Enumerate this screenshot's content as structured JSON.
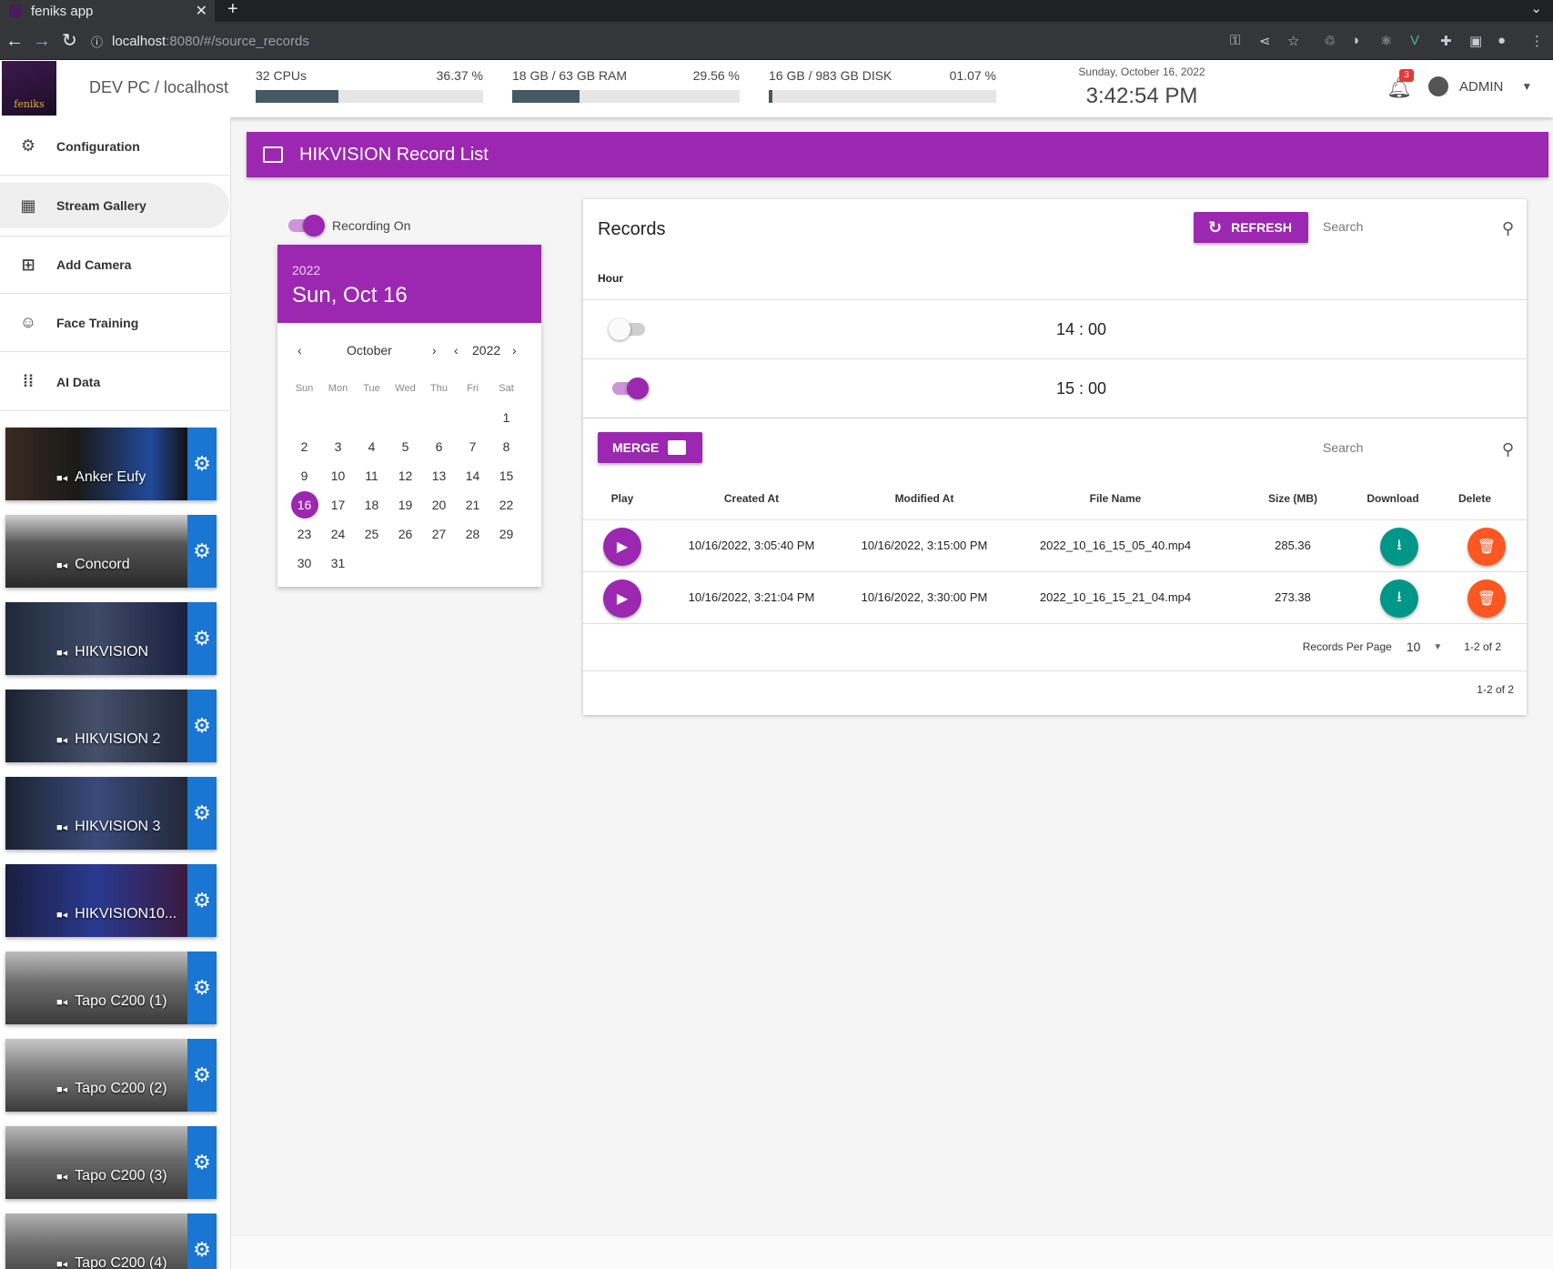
{
  "browser": {
    "tab_title": "feniks app",
    "url_host": "localhost",
    "url_rest": ":8080/#/source_records"
  },
  "header": {
    "logo_text": "feniks",
    "host": "DEV PC / localhost",
    "cpu": {
      "label": "32 CPUs",
      "percent_text": "36.37 %",
      "value": 0.3637
    },
    "ram": {
      "label": "18 GB / 63 GB RAM",
      "percent_text": "29.56 %",
      "value": 0.2956
    },
    "disk": {
      "label": "16 GB / 983 GB DISK",
      "percent_text": "01.07 %",
      "value": 0.0107
    },
    "date": "Sunday, October 16, 2022",
    "time": "3:42:54 PM",
    "notifications": "3",
    "user": "ADMIN"
  },
  "sidebar": {
    "items": [
      {
        "label": "Configuration",
        "icon": "gear-icon"
      },
      {
        "label": "Stream Gallery",
        "icon": "grid-icon"
      },
      {
        "label": "Add Camera",
        "icon": "add-box-icon"
      },
      {
        "label": "Face Training",
        "icon": "face-icon"
      },
      {
        "label": "AI Data",
        "icon": "dots-grid-icon"
      }
    ],
    "cameras": [
      {
        "name": "Anker Eufy"
      },
      {
        "name": "Concord"
      },
      {
        "name": "HIKVISION"
      },
      {
        "name": "HIKVISION 2"
      },
      {
        "name": "HIKVISION 3"
      },
      {
        "name": "HIKVISION10..."
      },
      {
        "name": "Tapo C200 (1)"
      },
      {
        "name": "Tapo C200 (2)"
      },
      {
        "name": "Tapo C200 (3)"
      },
      {
        "name": "Tapo C200 (4)"
      }
    ]
  },
  "page": {
    "title": "HIKVISION Record List",
    "recording_label": "Recording On",
    "recording_on": true
  },
  "calendar": {
    "year": "2022",
    "selected": "Sun, Oct 16",
    "month_name": "October",
    "weekdays": [
      "Sun",
      "Mon",
      "Tue",
      "Wed",
      "Thu",
      "Fri",
      "Sat"
    ],
    "weeks": [
      [
        "",
        "",
        "",
        "",
        "",
        "",
        "1"
      ],
      [
        "2",
        "3",
        "4",
        "5",
        "6",
        "7",
        "8"
      ],
      [
        "9",
        "10",
        "11",
        "12",
        "13",
        "14",
        "15"
      ],
      [
        "16",
        "17",
        "18",
        "19",
        "20",
        "21",
        "22"
      ],
      [
        "23",
        "24",
        "25",
        "26",
        "27",
        "28",
        "29"
      ],
      [
        "30",
        "31",
        "",
        "",
        "",
        "",
        ""
      ]
    ],
    "selected_day": "16"
  },
  "records": {
    "title": "Records",
    "refresh_label": "REFRESH",
    "search_placeholder": "Search",
    "hour_header": "Hour",
    "hours": [
      {
        "time": "14 : 00",
        "enabled": false
      },
      {
        "time": "15 : 00",
        "enabled": true
      }
    ],
    "merge_label": "MERGE",
    "columns": [
      "Play",
      "Created At",
      "Modified At",
      "File Name",
      "Size (MB)",
      "Download",
      "Delete"
    ],
    "rows": [
      {
        "created": "10/16/2022, 3:05:40 PM",
        "modified": "10/16/2022, 3:15:00 PM",
        "file": "2022_10_16_15_05_40.mp4",
        "size": "285.36"
      },
      {
        "created": "10/16/2022, 3:21:04 PM",
        "modified": "10/16/2022, 3:30:00 PM",
        "file": "2022_10_16_15_21_04.mp4",
        "size": "273.38"
      }
    ],
    "per_page_label": "Records Per Page",
    "per_page": "10",
    "range": "1-2 of 2",
    "footer_range": "1-2 of 2"
  },
  "colors": {
    "primary": "#9c27b0",
    "gear": "#1976d2",
    "download": "#009688",
    "delete": "#ff5722"
  }
}
